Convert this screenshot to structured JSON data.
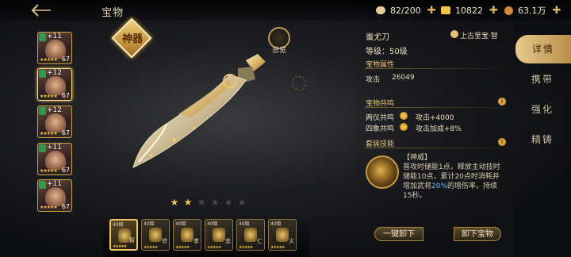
{
  "header": {
    "title": "宝物"
  },
  "resources": [
    {
      "icon": "stamina-icon",
      "value": "82/200",
      "color": "#e4cf9c"
    },
    {
      "icon": "gold-ingot-icon",
      "value": "10822",
      "color": "#f2c447"
    },
    {
      "icon": "coin-icon",
      "value": "63.1万",
      "color": "#d28a3b"
    }
  ],
  "heroes": [
    {
      "level": "+11",
      "number": "67",
      "stars": "★★★★★",
      "selected": false
    },
    {
      "level": "+12",
      "number": "67",
      "stars": "★★★★★",
      "selected": true
    },
    {
      "level": "+12",
      "number": "67",
      "stars": "★★★★★",
      "selected": false
    },
    {
      "level": "+11",
      "number": "67",
      "stars": "★★★★★",
      "selected": false
    },
    {
      "level": "+11",
      "number": "67",
      "stars": "★★★★★",
      "selected": false
    }
  ],
  "treasure": {
    "emblem": "神器",
    "preview_label": "总览",
    "name": "蚩尤刀",
    "rank": "上古至宝·智",
    "level_label": "等级：50级",
    "stars_filled": 2,
    "stars_total": 6
  },
  "attributes": {
    "header": "宝物属性",
    "attack_label": "攻击",
    "attack_value": "26049"
  },
  "resonance": {
    "header": "宝物共鸣",
    "rows": [
      {
        "label": "两仪共鸣",
        "effect": "攻击+4000"
      },
      {
        "label": "四象共鸣",
        "effect": "攻击加成+8%"
      }
    ]
  },
  "skill": {
    "header": "套装技能",
    "name": "【神威】",
    "desc_before": "普攻时储能1点，释放主动技时储能10点，累计20点时消耗并增加武将",
    "desc_highlight": "20%",
    "desc_after": "的增伤率，持续15秒。"
  },
  "slots": [
    {
      "level": "40级",
      "kind": "智",
      "stars": "★★★★★"
    },
    {
      "level": "40级",
      "kind": "信",
      "stars": "★★★★★"
    },
    {
      "level": "40级",
      "kind": "孝",
      "stars": "★★★★★"
    },
    {
      "level": "40级",
      "kind": "忠",
      "stars": "★★★★★"
    },
    {
      "level": "40级",
      "kind": "仁",
      "stars": "★★★★★"
    },
    {
      "level": "40级",
      "kind": "义",
      "stars": "★★★★★"
    }
  ],
  "buttons": {
    "unequip_all": "一键卸下",
    "unequip": "卸下宝物"
  },
  "tabs": [
    "详情",
    "携带",
    "强化",
    "精铸"
  ],
  "active_tab": 0
}
